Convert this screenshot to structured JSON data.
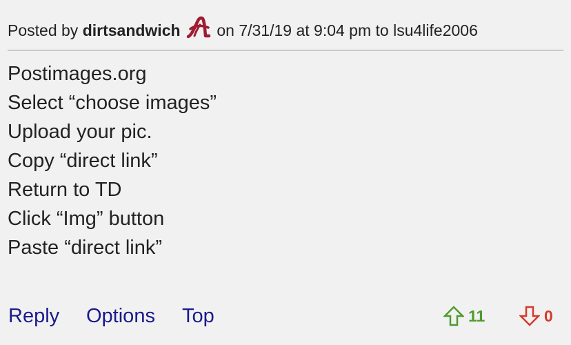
{
  "post": {
    "posted_by_label": "Posted by",
    "author": "dirtsandwich",
    "on_label": "on",
    "date": "7/31/19",
    "at_label": "at",
    "time": "9:04 pm",
    "to_label": "to",
    "reply_to": "lsu4life2006",
    "team_logo_icon": "alabama-script-a-icon",
    "team_logo_color": "#9e1b32",
    "lines": [
      "Postimages.org",
      "Select “choose images”",
      "Upload your pic.",
      "Copy “direct link”",
      "Return to TD",
      "Click “Img” button",
      "Paste “direct link”"
    ]
  },
  "footer": {
    "reply_label": "Reply",
    "options_label": "Options",
    "top_label": "Top",
    "upvote_icon": "arrow-up-icon",
    "upvote_count": "11",
    "upvote_color": "#4f9a2f",
    "downvote_icon": "arrow-down-icon",
    "downvote_count": "0",
    "downvote_color": "#d33a2c",
    "link_color": "#1a1a8c"
  }
}
